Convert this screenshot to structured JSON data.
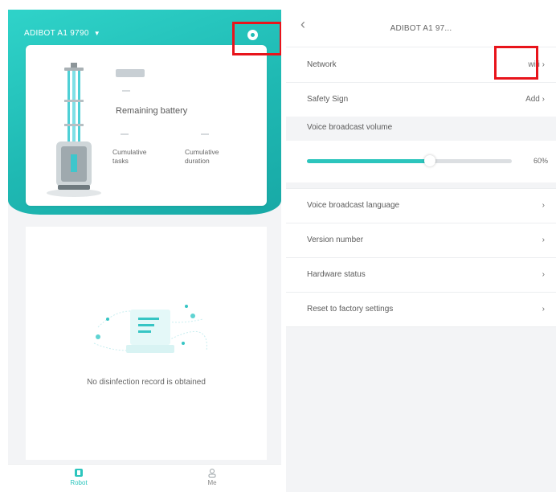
{
  "left_screen": {
    "device_title": "ADIBOT A1 9790",
    "robot_status_badge": "",
    "remaining_battery_label": "Remaining battery",
    "cumulative_tasks_label": "Cumulative tasks",
    "cumulative_duration_label": "Cumulative duration",
    "empty_message": "No disinfection record is obtained",
    "tabs": [
      {
        "label": "Robot",
        "icon": "robot-icon"
      },
      {
        "label": "Me",
        "icon": "person-icon"
      }
    ],
    "colors": {
      "accent": "#22bdb6",
      "highlight": "#e8141b"
    }
  },
  "right_screen": {
    "title": "ADIBOT A1 97...",
    "network": {
      "label": "Network",
      "value": "wifi"
    },
    "safety_sign": {
      "label": "Safety Sign",
      "value": "Add"
    },
    "volume_section": "Voice broadcast volume",
    "volume": {
      "value": 0.6,
      "label": "60%"
    },
    "items": [
      {
        "label": "Voice broadcast language"
      },
      {
        "label": "Version number"
      },
      {
        "label": "Hardware status"
      },
      {
        "label": "Reset to factory settings"
      }
    ]
  }
}
